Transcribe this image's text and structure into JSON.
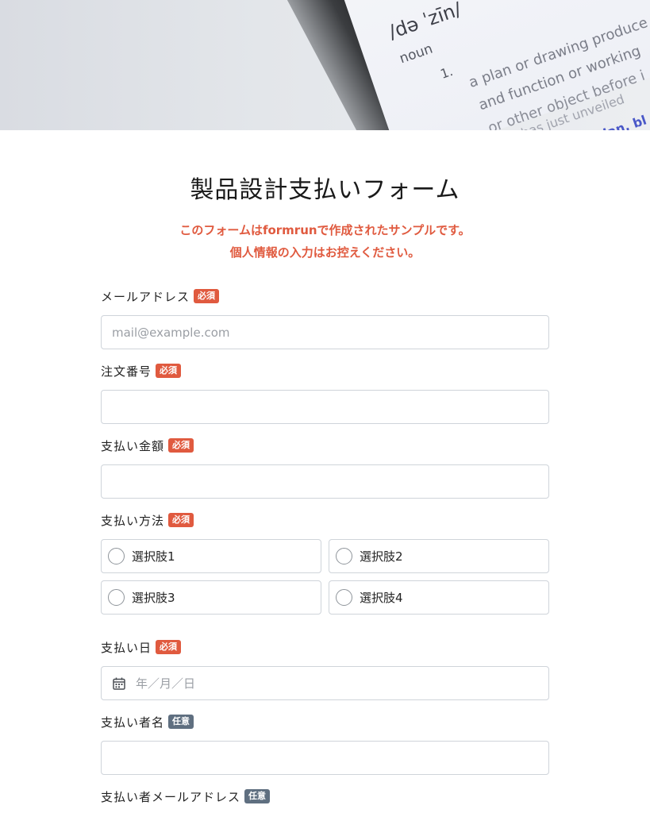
{
  "hero": {
    "dict_pron": "/də ˈzīn/",
    "dict_pos": "noun",
    "dict_num": "1.",
    "dict_line1": "a plan or drawing produce",
    "dict_line2": "and function or working",
    "dict_line3": "or other object before i",
    "dict_line4": "\"he has just unveiled",
    "dict_link": "plan, bl"
  },
  "form": {
    "title": "製品設計支払いフォーム",
    "notice_line1": "このフォームはformrunで作成されたサンプルです。",
    "notice_line2": "個人情報の入力はお控えください。",
    "badge_required": "必須",
    "badge_optional": "任意",
    "fields": {
      "email": {
        "label": "メールアドレス",
        "placeholder": "mail@example.com"
      },
      "order_no": {
        "label": "注文番号",
        "placeholder": ""
      },
      "amount": {
        "label": "支払い金額",
        "placeholder": ""
      },
      "method": {
        "label": "支払い方法",
        "options": [
          "選択肢1",
          "選択肢2",
          "選択肢3",
          "選択肢4"
        ]
      },
      "date": {
        "label": "支払い日",
        "placeholder": "年／月／日"
      },
      "payer_name": {
        "label": "支払い者名",
        "placeholder": ""
      },
      "payer_email": {
        "label": "支払い者メールアドレス"
      }
    }
  },
  "colors": {
    "required": "#e05a3f",
    "optional": "#5f6f80",
    "notice": "#e05a3f"
  }
}
